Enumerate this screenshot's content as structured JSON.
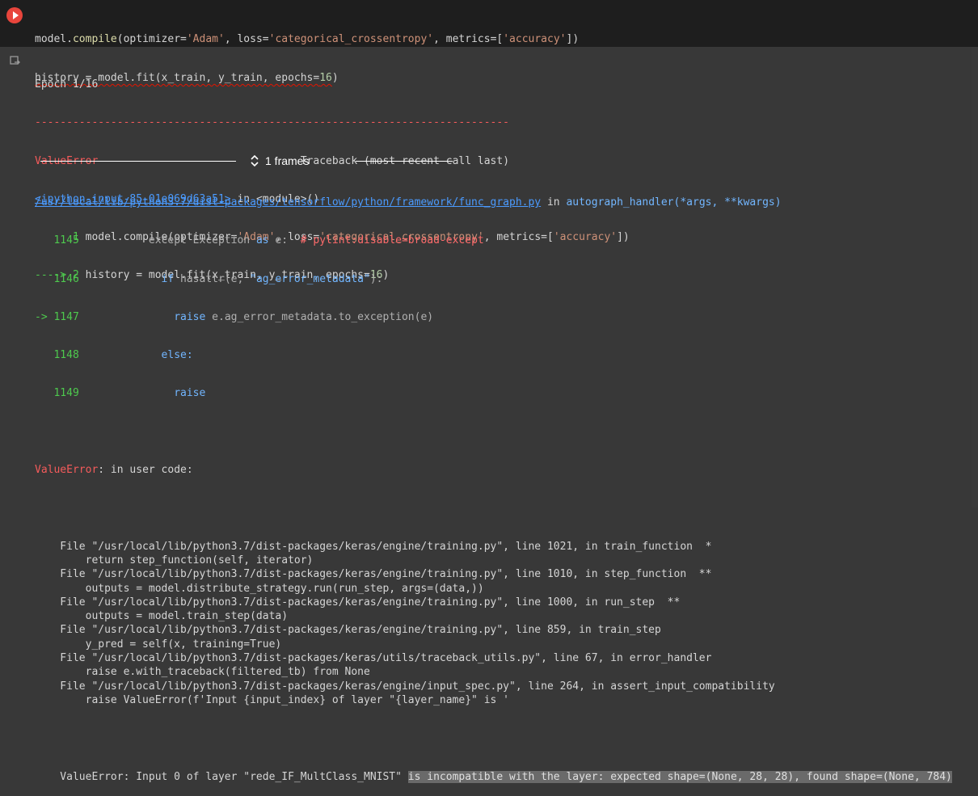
{
  "cell": {
    "code": {
      "line1": {
        "p1": "model.",
        "p2": "compile",
        "p3": "(optimizer=",
        "p4": "'Adam'",
        "p5": ", loss=",
        "p6": "'categorical_crossentropy'",
        "p7": ", metrics=[",
        "p8": "'accuracy'",
        "p9": "])"
      },
      "line2": {
        "p1": "history = model.fit(x_train, y_train, epochs=",
        "p2": "16",
        "p3": ")"
      }
    }
  },
  "output": {
    "epoch": "Epoch 1/16",
    "dashes": "---------------------------------------------------------------------------",
    "error_name": "ValueError",
    "traceback_header": "                                Traceback (most recent call last)",
    "input_link": "<ipython-input-85-01e069d63a51>",
    "in_module": " in <module>()",
    "src1_num": "      1 ",
    "src1_a": "model.compile(optimizer=",
    "src1_b": "'Adam'",
    "src1_c": ", loss=",
    "src1_d": "'categorical_crossentropy'",
    "src1_e": ", metrics=[",
    "src1_f": "'accuracy'",
    "src1_g": "])",
    "src2_num": "----> 2 ",
    "src2_a": "history = model.fit(x_train, y_train, epochs=",
    "src2_b": "16",
    "src2_c": ")",
    "frames_label": "1 frames",
    "func_graph_link": "/usr/local/lib/python3.7/dist-packages/tensorflow/python/framework/func_graph.py",
    "in_word": " in ",
    "handler": "autograph_handler(*args, **kwargs)",
    "l1145_num": "   1145 ",
    "l1145_a": "          except Exception ",
    "l1145_b": "as",
    "l1145_c": " e:  ",
    "l1145_d": "# pylint:disable=broad-except",
    "l1146_num": "   1146 ",
    "l1146_a": "            ",
    "l1146_b": "if",
    "l1146_c": " hasattr(e, ",
    "l1146_d": "\"ag_error_metadata\"",
    "l1146_e": "):",
    "l1147_num": "-> 1147 ",
    "l1147_a": "              ",
    "l1147_b": "raise",
    "l1147_c": " e.ag_error_metadata.to_exception(e)",
    "l1148_num": "   1148 ",
    "l1148_a": "            ",
    "l1148_b": "else:",
    "l1149_num": "   1149 ",
    "l1149_a": "              ",
    "l1149_b": "raise",
    "final_error_name": "ValueError",
    "in_user_code": ": in user code:",
    "tb": [
      "    File \"/usr/local/lib/python3.7/dist-packages/keras/engine/training.py\", line 1021, in train_function  *",
      "        return step_function(self, iterator)",
      "    File \"/usr/local/lib/python3.7/dist-packages/keras/engine/training.py\", line 1010, in step_function  **",
      "        outputs = model.distribute_strategy.run(run_step, args=(data,))",
      "    File \"/usr/local/lib/python3.7/dist-packages/keras/engine/training.py\", line 1000, in run_step  **",
      "        outputs = model.train_step(data)",
      "    File \"/usr/local/lib/python3.7/dist-packages/keras/engine/training.py\", line 859, in train_step",
      "        y_pred = self(x, training=True)",
      "    File \"/usr/local/lib/python3.7/dist-packages/keras/utils/traceback_utils.py\", line 67, in error_handler",
      "        raise e.with_traceback(filtered_tb) from None",
      "    File \"/usr/local/lib/python3.7/dist-packages/keras/engine/input_spec.py\", line 264, in assert_input_compatibility",
      "        raise ValueError(f'Input {input_index} of layer \"{layer_name}\" is '"
    ],
    "last_a": "    ValueError: Input 0 of layer \"rede_IF_MultClass_MNIST\" ",
    "last_b": "is incompatible with the layer: expected shape=(None, 28, 28), found shape=(None, 784)"
  }
}
